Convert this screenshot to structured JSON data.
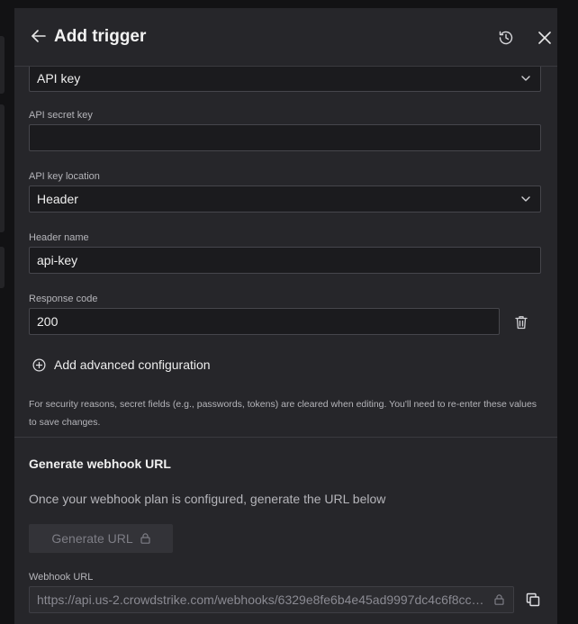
{
  "header": {
    "title": "Add trigger"
  },
  "form": {
    "auth_type": {
      "value": "API key"
    },
    "api_secret_key": {
      "label": "API secret key",
      "value": ""
    },
    "api_key_location": {
      "label": "API key location",
      "value": "Header"
    },
    "header_name": {
      "label": "Header name",
      "value": "api-key"
    },
    "response_code": {
      "label": "Response code",
      "value": "200"
    },
    "advanced_label": "Add advanced configuration",
    "note": "For security reasons, secret fields (e.g., passwords, tokens) are cleared when editing. You'll need to re-enter these values to save changes."
  },
  "webhook": {
    "title": "Generate webhook URL",
    "description": "Once your webhook plan is configured, generate the URL below",
    "generate_label": "Generate URL",
    "url_label": "Webhook URL",
    "url_value": "https://api.us-2.crowdstrike.com/webhooks/6329e8fe6b4e45ad9997dc4c6f8cce..."
  },
  "icons": {
    "back": "arrow-left-icon",
    "history": "history-icon",
    "close": "close-icon",
    "chevron": "chevron-down-icon",
    "trash": "trash-icon",
    "add": "plus-circle-icon",
    "lock": "lock-icon",
    "copy": "copy-icon"
  },
  "colors": {
    "panel": "#26262a",
    "input_bg": "#1b1b1e",
    "border": "#46464c",
    "muted_text": "#b5b5ba",
    "disabled_text": "#7d7d85"
  }
}
